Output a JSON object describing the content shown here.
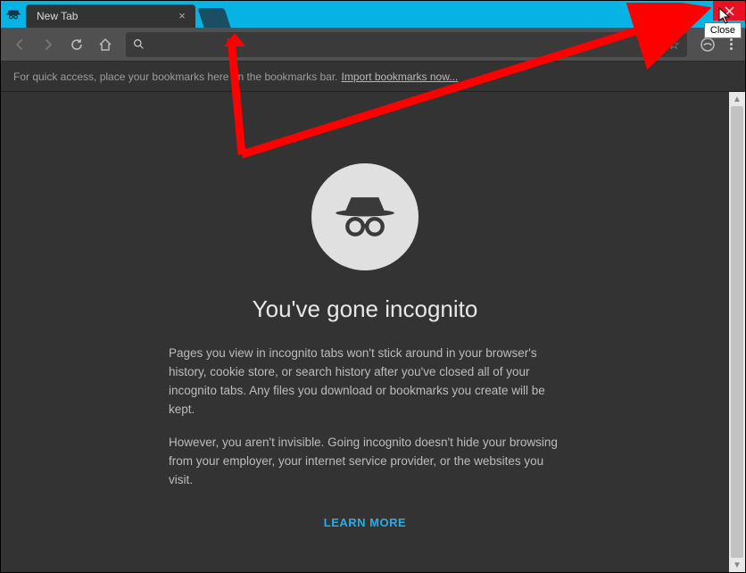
{
  "window": {
    "tab_title": "New Tab",
    "close_tooltip": "Close"
  },
  "bookmarks_bar": {
    "hint_text": "For quick access, place your bookmarks here on the bookmarks bar.",
    "import_link": "Import bookmarks now..."
  },
  "incognito": {
    "headline": "You've gone incognito",
    "paragraph1": "Pages you view in incognito tabs won't stick around in your browser's history, cookie store, or search history after you've closed all of your incognito tabs. Any files you download or bookmarks you create will be kept.",
    "paragraph2": "However, you aren't invisible. Going incognito doesn't hide your browsing from your employer, your internet service provider, or the websites you visit.",
    "learn_more": "LEARN MORE"
  },
  "omnibox": {
    "placeholder": ""
  }
}
